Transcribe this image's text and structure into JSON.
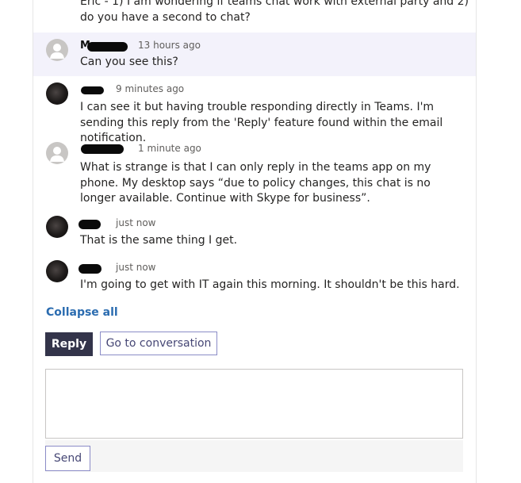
{
  "messages": [
    {
      "id": "top",
      "text": "Eric - 1) I am wondering if teams chat work with external party and 2) do you have a second to chat?"
    },
    {
      "id": "m1",
      "time": "13 hours ago",
      "text": "Can you see this?",
      "name_visible": "M"
    },
    {
      "id": "m2",
      "time": "9 minutes ago",
      "text": "I can see it but having trouble responding directly in Teams. I'm sending this reply from the 'Reply' feature found within the email notification."
    },
    {
      "id": "m3",
      "time": "1 minute ago",
      "text": "What is strange is that I can only reply in the teams app on my phone. My desktop says “due to policy changes, this chat is no longer available. Continue with Skype for business”."
    },
    {
      "id": "m4",
      "time": "just now",
      "text": "That is the same thing I get."
    },
    {
      "id": "m5",
      "time": "just now",
      "text": "I'm going to get with IT again this morning. It shouldn't be this hard."
    }
  ],
  "actions": {
    "collapse_all": "Collapse all",
    "reply": "Reply",
    "go_to_conversation": "Go to conversation",
    "send": "Send"
  },
  "colors": {
    "highlight": "#f3f2fb",
    "primary_button": "#33344a",
    "link": "#2b6cb0",
    "secondary_border": "#8b8cc7"
  }
}
